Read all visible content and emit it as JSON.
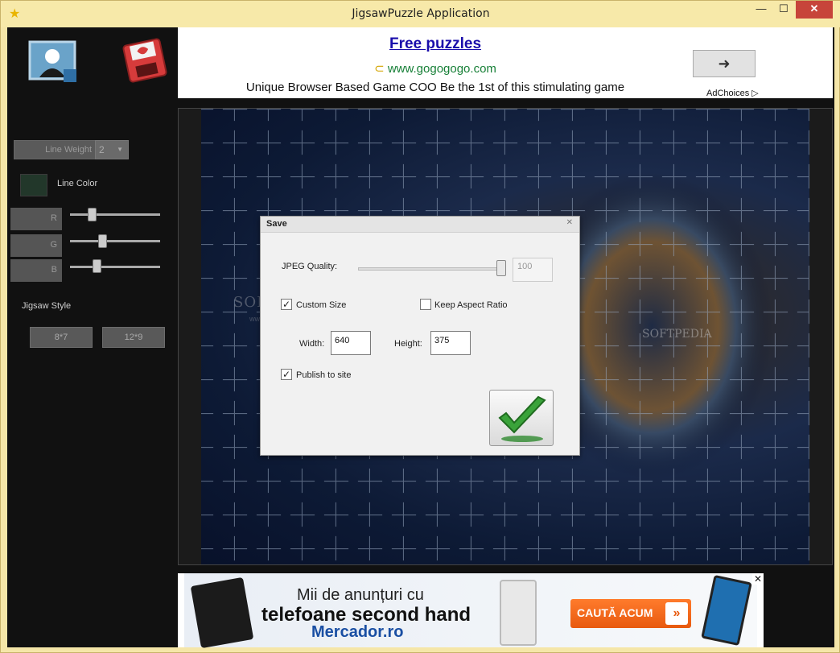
{
  "window": {
    "title": "JigsawPuzzle Application",
    "minimize": "—",
    "maximize": "☐",
    "close": "✕"
  },
  "sidebar": {
    "line_weight_label": "Line Weight",
    "line_weight_value": "2",
    "line_color_label": "Line Color",
    "line_color": "#22372a",
    "r_label": "R",
    "g_label": "G",
    "b_label": "B",
    "jigsaw_style_label": "Jigsaw Style",
    "style_buttons": [
      "8*7",
      "12*9"
    ]
  },
  "top_ad": {
    "title": "Free puzzles",
    "url": "www.gogogogo.com",
    "description": "Unique Browser Based Game COO Be the 1st of this stimulating game",
    "arrow": "➜",
    "adchoices": "AdChoices ▷"
  },
  "puzzle": {
    "watermark_left": "SOFTPEDIA",
    "watermark_left_sub": "www.softpedia.com",
    "watermark_right": "SOFTPEDIA"
  },
  "save_dialog": {
    "title": "Save",
    "close": "✕",
    "jpeg_quality_label": "JPEG Quality:",
    "jpeg_quality_value": "100",
    "custom_size_label": "Custom Size",
    "custom_size_checked": true,
    "keep_aspect_label": "Keep Aspect Ratio",
    "keep_aspect_checked": false,
    "width_label": "Width:",
    "width_value": "640",
    "height_label": "Height:",
    "height_value": "375",
    "publish_label": "Publish to site",
    "publish_checked": true
  },
  "bottom_ad": {
    "line1": "Mii de anunțuri cu",
    "line2": "telefoane second hand",
    "line3": "Mercador.ro",
    "cta": "CAUTĂ ACUM",
    "cta_chevron": "»",
    "info": "▷",
    "close": "✕"
  },
  "colors": {
    "titlebar": "#f7e9a9",
    "close_button": "#c7443a",
    "link": "#1a0dab",
    "url": "#188038"
  }
}
